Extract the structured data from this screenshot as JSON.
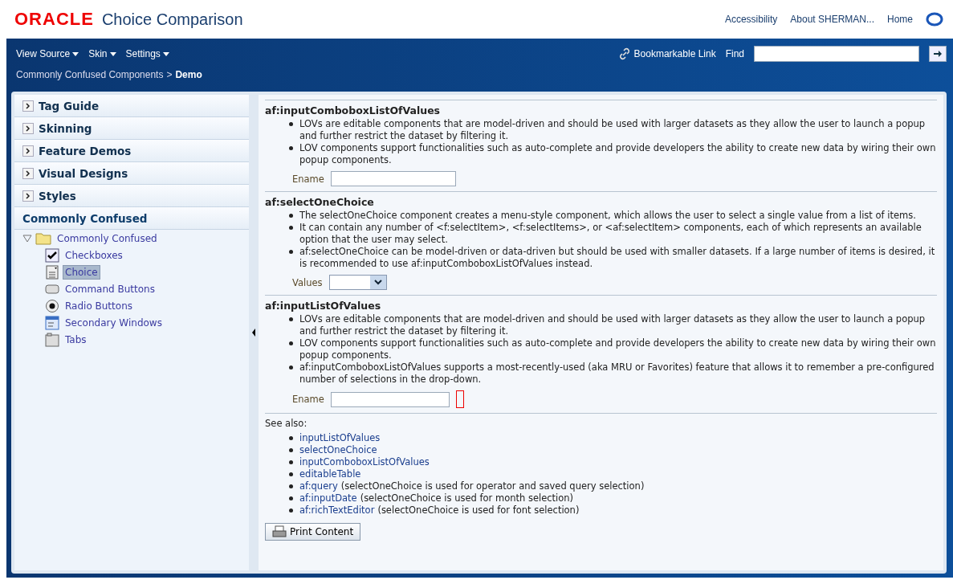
{
  "header": {
    "brand": "ORACLE",
    "title": "Choice Comparison",
    "links": [
      "Accessibility",
      "About SHERMAN...",
      "Home"
    ]
  },
  "toolbar": {
    "menus": [
      "View Source",
      "Skin",
      "Settings"
    ],
    "bookmark": "Bookmarkable Link",
    "find_label": "Find",
    "breadcrumb": {
      "path": "Commonly Confused Components",
      "separator": ">",
      "current": "Demo"
    }
  },
  "accordion": [
    {
      "label": "Tag Guide",
      "expanded": false
    },
    {
      "label": "Skinning",
      "expanded": false
    },
    {
      "label": "Feature Demos",
      "expanded": false
    },
    {
      "label": "Visual Designs",
      "expanded": false
    },
    {
      "label": "Styles",
      "expanded": false
    },
    {
      "label": "Commonly Confused",
      "expanded": true
    }
  ],
  "tree": {
    "label": "Commonly Confused",
    "expanded": true,
    "children": [
      {
        "label": "Checkboxes",
        "kind": "checkbox",
        "selected": false
      },
      {
        "label": "Choice",
        "kind": "choice",
        "selected": true
      },
      {
        "label": "Command Buttons",
        "kind": "button",
        "selected": false
      },
      {
        "label": "Radio Buttons",
        "kind": "radio",
        "selected": false
      },
      {
        "label": "Secondary Windows",
        "kind": "window",
        "selected": false
      },
      {
        "label": "Tabs",
        "kind": "tabs",
        "selected": false
      }
    ]
  },
  "sections": [
    {
      "title": "af:inputComboboxListOfValues",
      "bullets": [
        "LOVs are editable components that are model-driven and should be used with larger datasets as they allow the user to launch a popup and further restrict the dataset by filtering it.",
        "LOV components support functionalities such as auto-complete and provide developers the ability to create new data by wiring their own popup components."
      ],
      "field": {
        "label": "Ename",
        "kind": "combo"
      }
    },
    {
      "title": "af:selectOneChoice",
      "bullets": [
        "The selectOneChoice component creates a menu-style component, which allows the user to select a single value from a list of items.",
        "It can contain any number of <f:selectItem>, <f:selectItems>, or <af:selectItem> components, each of which represents an available option that the user may select.",
        "af:selectOneChoice can be model-driven or data-driven but should be used with smaller datasets. If a large number of items is desired, it is recommended to use af:inputComboboxListOfValues instead."
      ],
      "field": {
        "label": "Values",
        "kind": "choice"
      }
    },
    {
      "title": "af:inputListOfValues",
      "bullets": [
        "LOVs are editable components that are model-driven and should be used with larger datasets as they allow the user to launch a popup and further restrict the dataset by filtering it.",
        "LOV components support functionalities such as auto-complete and provide developers the ability to create new data by wiring their own popup components.",
        "af:inputComboboxListOfValues supports a most-recently-used (aka MRU or Favorites) feature that allows it to remember a pre-configured number of selections in the drop-down."
      ],
      "field": {
        "label": "Ename",
        "kind": "lov"
      }
    }
  ],
  "see_also": {
    "label": "See also:",
    "items": [
      {
        "link": "inputListOfValues"
      },
      {
        "link": "selectOneChoice"
      },
      {
        "link": "inputComboboxListOfValues"
      },
      {
        "link": "editableTable"
      },
      {
        "link": "af:query",
        "note": "(selectOneChoice is used for operator and saved query selection)"
      },
      {
        "link": "af:inputDate",
        "note": "(selectOneChoice is used for month selection)"
      },
      {
        "link": "af:richTextEditor",
        "note": "(selectOneChoice is used for font selection)"
      }
    ]
  },
  "print_button": "Print Content"
}
